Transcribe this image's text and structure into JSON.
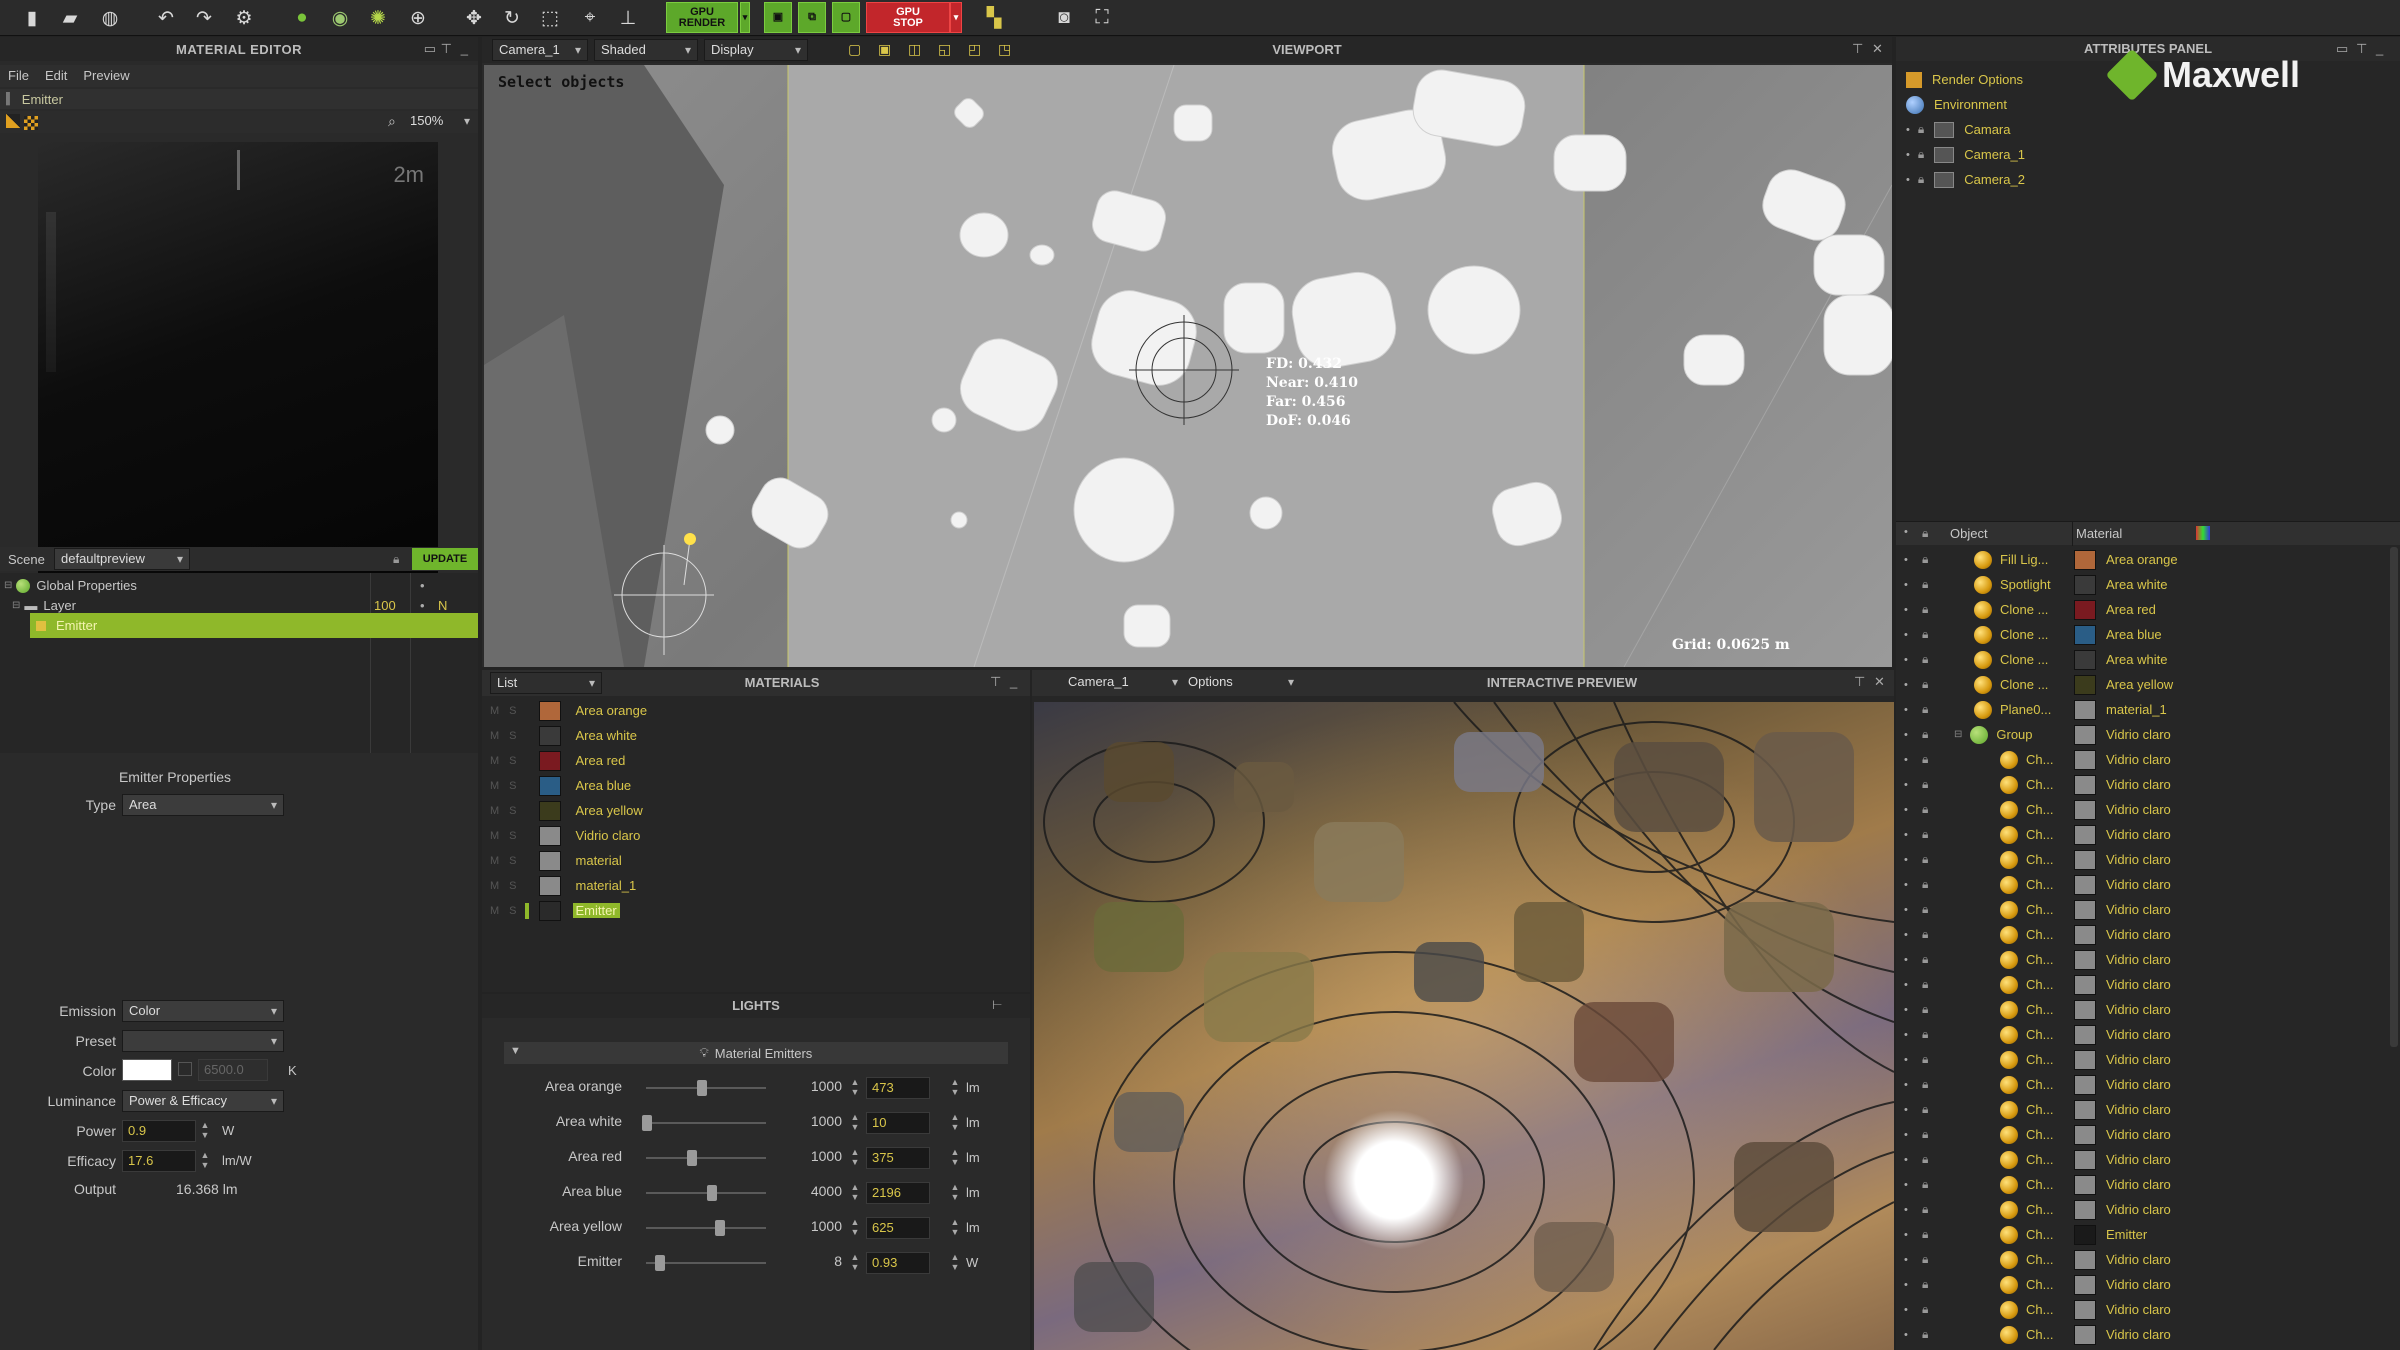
{
  "toolbar": {
    "render_top": "GPU",
    "render_label": "RENDER",
    "stop_top": "GPU",
    "stop_label": "STOP"
  },
  "material_editor": {
    "title": "MATERIAL EDITOR",
    "menu": [
      "File",
      "Edit",
      "Preview"
    ],
    "breadcrumb": "Emitter",
    "zoom": "150%",
    "preview_scale": "2m",
    "scene_label": "Scene",
    "scene_value": "defaultpreview",
    "update_label": "UPDATE",
    "tree": {
      "global": "Global Properties",
      "layer": "Layer",
      "layer_value": "100",
      "layer_flag": "N",
      "emitter": "Emitter"
    },
    "props_title": "Emitter Properties",
    "type_label": "Type",
    "type_value": "Area",
    "emission_label": "Emission",
    "emission_value": "Color",
    "preset_label": "Preset",
    "preset_value": "",
    "color_label": "Color",
    "color_temp": "6500.0",
    "color_unit": "K",
    "luminance_label": "Luminance",
    "luminance_value": "Power & Efficacy",
    "power_label": "Power",
    "power_value": "0.9",
    "power_unit": "W",
    "efficacy_label": "Efficacy",
    "efficacy_value": "17.6",
    "efficacy_unit": "lm/W",
    "output_label": "Output",
    "output_value": "16.368 lm"
  },
  "viewport": {
    "title": "VIEWPORT",
    "camera": "Camera_1",
    "shading": "Shaded",
    "display": "Display",
    "hint": "Select objects",
    "fd": "FD: 0.432",
    "near": "Near: 0.410",
    "far": "Far: 0.456",
    "dof": "DoF: 0.046",
    "grid": "Grid: 0.0625 m"
  },
  "materials_panel": {
    "title": "MATERIALS",
    "mode": "List",
    "flag_m": "M",
    "flag_s": "S",
    "items": [
      {
        "name": "Area orange",
        "color": "#b0673a"
      },
      {
        "name": "Area white",
        "color": "#3a3a3a"
      },
      {
        "name": "Area red",
        "color": "#7a1a20"
      },
      {
        "name": "Area blue",
        "color": "#2a5d86"
      },
      {
        "name": "Area yellow",
        "color": "#3b3b1c"
      },
      {
        "name": "Vidrio claro",
        "color": "#8a8a8a"
      },
      {
        "name": "material",
        "color": "#8a8a8a"
      },
      {
        "name": "material_1",
        "color": "#8a8a8a"
      },
      {
        "name": "Emitter",
        "color": "#2a2a2a"
      }
    ]
  },
  "lights_panel": {
    "title": "LIGHTS",
    "group": "Material Emitters",
    "rows": [
      {
        "name": "Area orange",
        "max": "1000",
        "value": "473",
        "unit": "lm",
        "level": 0.47
      },
      {
        "name": "Area white",
        "max": "1000",
        "value": "10",
        "unit": "lm",
        "level": 0.01
      },
      {
        "name": "Area red",
        "max": "1000",
        "value": "375",
        "unit": "lm",
        "level": 0.38
      },
      {
        "name": "Area blue",
        "max": "4000",
        "value": "2196",
        "unit": "lm",
        "level": 0.55
      },
      {
        "name": "Area yellow",
        "max": "1000",
        "value": "625",
        "unit": "lm",
        "level": 0.62
      },
      {
        "name": "Emitter",
        "max": "8",
        "value": "0.93",
        "unit": "W",
        "level": 0.12
      }
    ]
  },
  "interactive_preview": {
    "title": "INTERACTIVE PREVIEW",
    "camera": "Camera_1",
    "options": "Options"
  },
  "attributes_panel": {
    "title": "ATTRIBUTES PANEL",
    "logo": "Maxwell",
    "render_options": "Render Options",
    "environment": "Environment",
    "cameras": [
      "Camara",
      "Camera_1",
      "Camera_2"
    ]
  },
  "object_list": {
    "col_object": "Object",
    "col_material": "Material",
    "rows": [
      {
        "object": "Fill Lig...",
        "material": "Area orange",
        "swatch": "#b0673a",
        "indent": 0
      },
      {
        "object": "Spotlight",
        "material": "Area white",
        "swatch": "#3a3a3a",
        "indent": 0
      },
      {
        "object": "Clone ...",
        "material": "Area red",
        "swatch": "#7a1a20",
        "indent": 0
      },
      {
        "object": "Clone ...",
        "material": "Area blue",
        "swatch": "#2a5d86",
        "indent": 0
      },
      {
        "object": "Clone ...",
        "material": "Area white",
        "swatch": "#3a3a3a",
        "indent": 0
      },
      {
        "object": "Clone ...",
        "material": "Area yellow",
        "swatch": "#3b3b1c",
        "indent": 0
      },
      {
        "object": "Plane0...",
        "material": "material_1",
        "swatch": "#8a8a8a",
        "indent": 0
      },
      {
        "object": "Group",
        "material": "Vidrio claro",
        "swatch": "#8a8a8a",
        "indent": 0
      },
      {
        "object": "Ch...",
        "material": "Vidrio claro",
        "swatch": "#8a8a8a",
        "indent": 1
      },
      {
        "object": "Ch...",
        "material": "Vidrio claro",
        "swatch": "#8a8a8a",
        "indent": 1
      },
      {
        "object": "Ch...",
        "material": "Vidrio claro",
        "swatch": "#8a8a8a",
        "indent": 1
      },
      {
        "object": "Ch...",
        "material": "Vidrio claro",
        "swatch": "#8a8a8a",
        "indent": 1
      },
      {
        "object": "Ch...",
        "material": "Vidrio claro",
        "swatch": "#8a8a8a",
        "indent": 1
      },
      {
        "object": "Ch...",
        "material": "Vidrio claro",
        "swatch": "#8a8a8a",
        "indent": 1
      },
      {
        "object": "Ch...",
        "material": "Vidrio claro",
        "swatch": "#8a8a8a",
        "indent": 1
      },
      {
        "object": "Ch...",
        "material": "Vidrio claro",
        "swatch": "#8a8a8a",
        "indent": 1
      },
      {
        "object": "Ch...",
        "material": "Vidrio claro",
        "swatch": "#8a8a8a",
        "indent": 1
      },
      {
        "object": "Ch...",
        "material": "Vidrio claro",
        "swatch": "#8a8a8a",
        "indent": 1
      },
      {
        "object": "Ch...",
        "material": "Vidrio claro",
        "swatch": "#8a8a8a",
        "indent": 1
      },
      {
        "object": "Ch...",
        "material": "Vidrio claro",
        "swatch": "#8a8a8a",
        "indent": 1
      },
      {
        "object": "Ch...",
        "material": "Vidrio claro",
        "swatch": "#8a8a8a",
        "indent": 1
      },
      {
        "object": "Ch...",
        "material": "Vidrio claro",
        "swatch": "#8a8a8a",
        "indent": 1
      },
      {
        "object": "Ch...",
        "material": "Vidrio claro",
        "swatch": "#8a8a8a",
        "indent": 1
      },
      {
        "object": "Ch...",
        "material": "Vidrio claro",
        "swatch": "#8a8a8a",
        "indent": 1
      },
      {
        "object": "Ch...",
        "material": "Vidrio claro",
        "swatch": "#8a8a8a",
        "indent": 1
      },
      {
        "object": "Ch...",
        "material": "Vidrio claro",
        "swatch": "#8a8a8a",
        "indent": 1
      },
      {
        "object": "Ch...",
        "material": "Vidrio claro",
        "swatch": "#8a8a8a",
        "indent": 1
      },
      {
        "object": "Ch...",
        "material": "Emitter",
        "swatch": "#1a1a1a",
        "indent": 1
      },
      {
        "object": "Ch...",
        "material": "Vidrio claro",
        "swatch": "#8a8a8a",
        "indent": 1
      },
      {
        "object": "Ch...",
        "material": "Vidrio claro",
        "swatch": "#8a8a8a",
        "indent": 1
      },
      {
        "object": "Ch...",
        "material": "Vidrio claro",
        "swatch": "#8a8a8a",
        "indent": 1
      },
      {
        "object": "Ch...",
        "material": "Vidrio claro",
        "swatch": "#8a8a8a",
        "indent": 1
      }
    ]
  }
}
